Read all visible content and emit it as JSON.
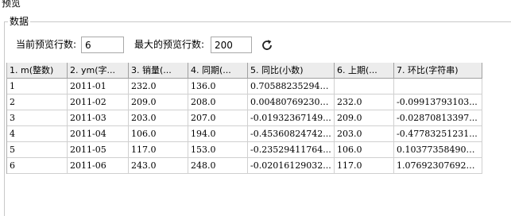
{
  "window": {
    "title": "预览"
  },
  "group": {
    "title": "数据"
  },
  "controls": {
    "preview_rows_label": "当前预览行数:",
    "preview_rows_value": "6",
    "max_rows_label": "最大的预览行数:",
    "max_rows_value": "200",
    "refresh_icon": "refresh-icon"
  },
  "table": {
    "headers": [
      "1. m(整数)",
      "2. ym(字...",
      "3. 销量(...",
      "4. 同期(...",
      "5. 同比(小数)",
      "6. 上期(...",
      "7. 环比(字符串)"
    ],
    "rows": [
      [
        "1",
        "2011-01",
        "232.0",
        "136.0",
        "0.705882352941...",
        "",
        ""
      ],
      [
        "2",
        "2011-02",
        "209.0",
        "208.0",
        "0.004807692307...",
        "232.0",
        "-0.09913793103..."
      ],
      [
        "3",
        "2011-03",
        "203.0",
        "207.0",
        "-0.01932367149...",
        "209.0",
        "-0.02870813397..."
      ],
      [
        "4",
        "2011-04",
        "106.0",
        "194.0",
        "-0.45360824742...",
        "203.0",
        "-0.47783251231..."
      ],
      [
        "5",
        "2011-05",
        "117.0",
        "153.0",
        "-0.23529411764...",
        "106.0",
        "0.10377358490566"
      ],
      [
        "6",
        "2011-06",
        "243.0",
        "248.0",
        "-0.02016129032...",
        "117.0",
        "1.07692307692308"
      ]
    ]
  }
}
